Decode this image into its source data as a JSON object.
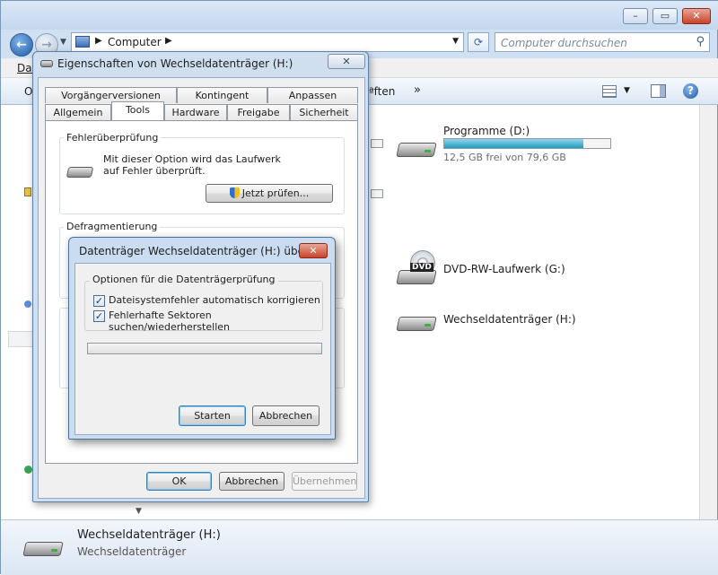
{
  "explorer": {
    "address": {
      "crumb": "Computer"
    },
    "search": {
      "placeholder": "Computer durchsuchen"
    },
    "menubar": {
      "first_item": "Dat"
    },
    "toolbar": {
      "left_text": "O",
      "visible_item": "ªften",
      "more": "»"
    },
    "drives": [
      {
        "name": "Programme (D:)",
        "free_text": "12,5 GB frei von 79,6 GB",
        "usage_fraction": 0.84,
        "bar_color": "#26a0c4"
      },
      {
        "name": "DVD-RW-Laufwerk (G:)",
        "disc_label": "DVD"
      },
      {
        "name": "Wechseldatenträger (H:)"
      }
    ],
    "details": {
      "title": "Wechseldatenträger (H:)",
      "subtitle": "Wechseldatenträger"
    }
  },
  "properties": {
    "title": "Eigenschaften von Wechseldatenträger (H:)",
    "tabs_row1": [
      "Vorgängerversionen",
      "Kontingent",
      "Anpassen"
    ],
    "tabs_row2": [
      "Allgemein",
      "Tools",
      "Hardware",
      "Freigabe",
      "Sicherheit"
    ],
    "active_tab": "Tools",
    "error_check": {
      "title": "Fehlerüberprüfung",
      "description": "Mit dieser Option wird das Laufwerk auf Fehler überprüft.",
      "button": "Jetzt prüfen..."
    },
    "defrag": {
      "title": "Defragmentierung"
    },
    "buttons": {
      "ok": "OK",
      "cancel": "Abbrechen",
      "apply": "Übernehmen"
    }
  },
  "checkdisk": {
    "title": "Datenträger Wechseldatenträger (H:) überp...",
    "group_title": "Optionen für die Datenträgerprüfung",
    "options": [
      {
        "label": "Dateisystemfehler automatisch korrigieren",
        "checked": true
      },
      {
        "label": "Fehlerhafte Sektoren suchen/wiederherstellen",
        "checked": true
      }
    ],
    "progress_fraction": 0.0,
    "buttons": {
      "start": "Starten",
      "cancel": "Abbrechen"
    }
  },
  "colors": {
    "accent": "#1f5aa8",
    "close_button": "#c8432b",
    "drive_bar": "#26a0c4"
  }
}
